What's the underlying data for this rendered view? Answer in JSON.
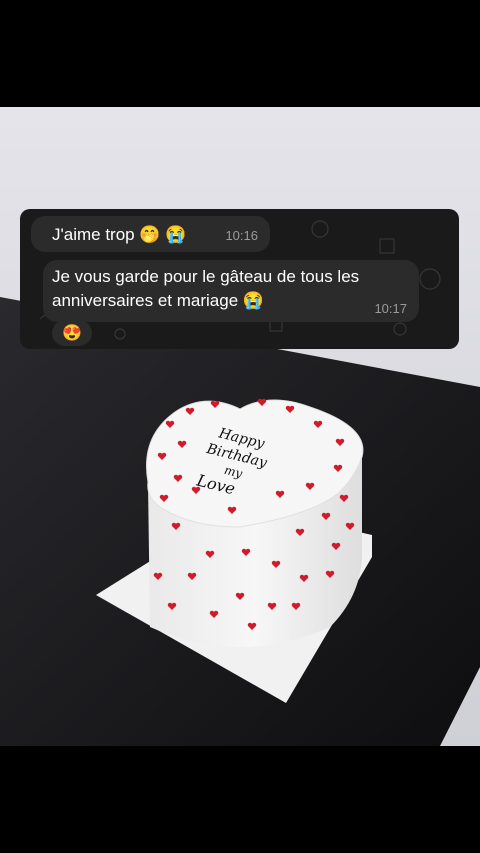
{
  "messages": [
    {
      "text": "J'aime trop 🤭 😭",
      "time": "10:16"
    },
    {
      "text": "Je vous garde pour le gâteau de tous les anniversaires et mariage 😭",
      "time": "10:17"
    }
  ],
  "reaction": "😍",
  "cake": {
    "inscription": [
      "Happy",
      "Birthday",
      "my",
      "Love"
    ]
  },
  "colors": {
    "accent_hearts": "#d11a2a",
    "chat_bg": "#1a1a1a",
    "bubble_bg": "#2b2b2b"
  }
}
